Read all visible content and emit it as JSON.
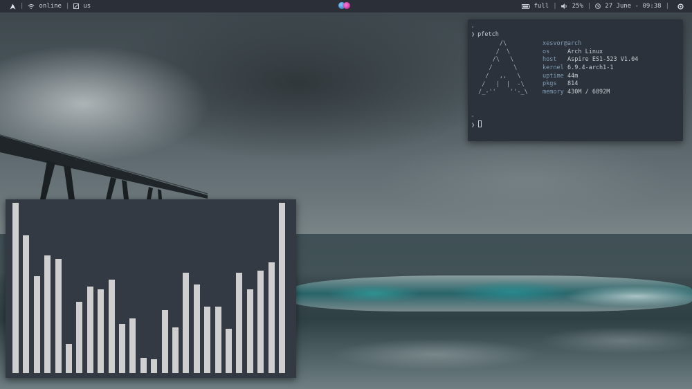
{
  "topbar": {
    "launcher_icon": "arch-logo-icon",
    "network_icon": "wifi-icon",
    "network_status": "online",
    "keyboard_icon": "keyboard-icon",
    "keyboard_layout": "us",
    "center_icons": [
      "app-icon-blue",
      "app-icon-pink"
    ],
    "battery_icon": "battery-icon",
    "battery_status": "full",
    "volume_icon": "volume-icon",
    "volume_level": "25%",
    "clock_icon": "clock-icon",
    "datetime": "27 June - 09:38",
    "power_icon": "power-icon"
  },
  "terminal": {
    "top_mark": "\"",
    "command": "pfetch",
    "ascii_logo": "       /\\\n      /  \\\n     /\\   \\\n    /      \\\n   /   ,,   \\\n  /   |  |  -\\\n /_-''    ''-_\\",
    "user_host": "xesvor@arch",
    "rows": [
      {
        "key": "os",
        "value": "Arch Linux"
      },
      {
        "key": "host",
        "value": "Aspire ES1-523 V1.04"
      },
      {
        "key": "kernel",
        "value": "6.9.4-arch1-1"
      },
      {
        "key": "uptime",
        "value": "44m"
      },
      {
        "key": "pkgs",
        "value": "814"
      },
      {
        "key": "memory",
        "value": "430M / 6892M"
      }
    ],
    "bottom_mark": "\""
  },
  "visualizer": {
    "bar_color": "#cfcfcf",
    "levels": [
      1.0,
      0.81,
      0.57,
      0.69,
      0.67,
      0.17,
      0.42,
      0.51,
      0.49,
      0.55,
      0.29,
      0.32,
      0.09,
      0.08,
      0.37,
      0.27,
      0.59,
      0.52,
      0.39,
      0.39,
      0.26,
      0.59,
      0.49,
      0.6,
      0.65,
      1.0
    ]
  },
  "colors": {
    "bar_background": "#2b3038",
    "terminal_background": "#2c323c",
    "visualizer_background": "#343a44",
    "accent_blue": "#7f9cb3"
  }
}
